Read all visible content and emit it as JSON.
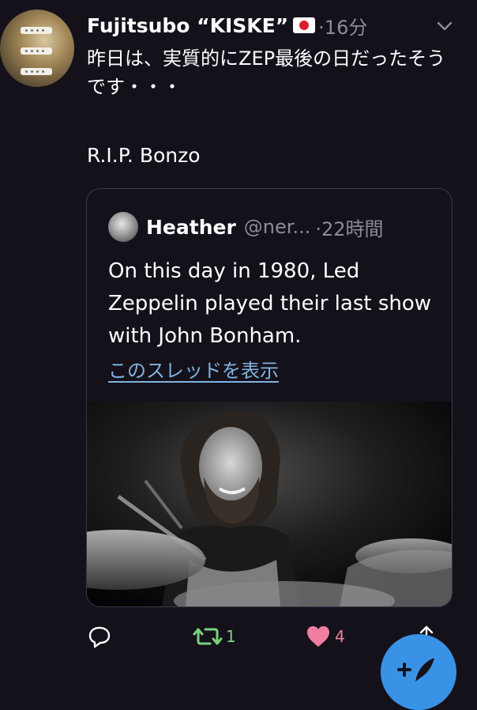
{
  "tweet": {
    "display_name": "Fujitsubo “KISKE”",
    "flag_icon": "japan-flag-icon",
    "time": "·16分",
    "text_line1": "昨日は、実質的にZEP最後の日だったそうです・・・",
    "text_line2": "R.I.P.  Bonzo"
  },
  "quote": {
    "display_name": "Heather",
    "handle": "@ner...",
    "time": "·22時間",
    "text": "On this day in 1980, Led Zeppelin played their last show with John Bonham.",
    "thread_link": "このスレッドを表示"
  },
  "actions": {
    "retweet_count": "1",
    "like_count": "4",
    "colors": {
      "retweet": "#7bd07e",
      "like": "#f07ea0",
      "icon": "#ffffff",
      "link": "#7fb4e0",
      "fab": "#3a92e6"
    }
  }
}
